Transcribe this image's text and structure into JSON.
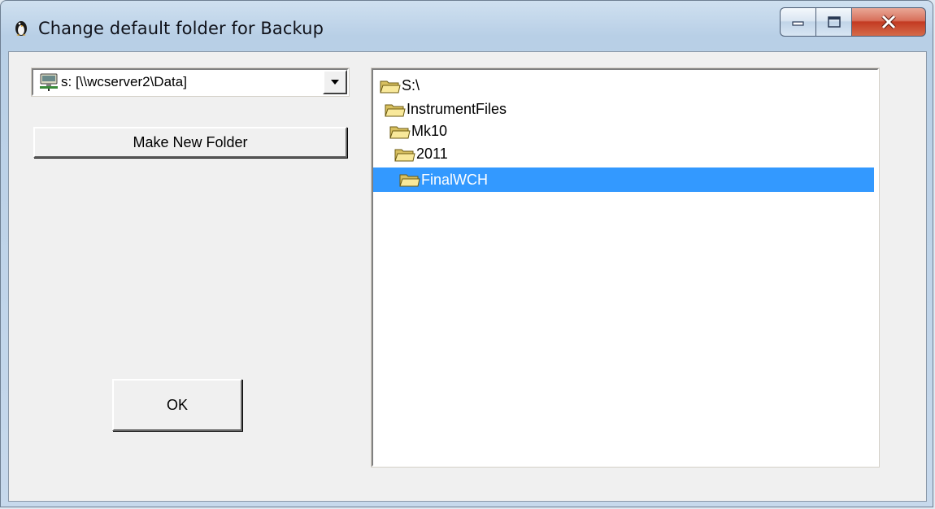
{
  "window": {
    "title": "Change default folder for Backup",
    "title_icon": "penguin-app-icon",
    "controls": [
      "minimize-icon",
      "maximize-icon",
      "close-icon"
    ]
  },
  "drive_combo": {
    "icon": "network-drive-icon",
    "selected": "s: [\\\\wcserver2\\Data]"
  },
  "buttons": {
    "make_new_folder": "Make New Folder",
    "ok": "OK"
  },
  "tree": {
    "items": [
      {
        "label": "S:\\",
        "icon": "open-folder-icon",
        "selected": false
      },
      {
        "label": "InstrumentFiles",
        "icon": "open-folder-icon",
        "selected": false
      },
      {
        "label": "Mk10",
        "icon": "open-folder-icon",
        "selected": false
      },
      {
        "label": "2011",
        "icon": "open-folder-icon",
        "selected": false
      },
      {
        "label": "FinalWCH",
        "icon": "open-folder-icon",
        "selected": true
      }
    ]
  },
  "colors": {
    "selection": "#3399ff",
    "dialog_bg": "#f0f0f0",
    "close_button": "#c33a22"
  }
}
